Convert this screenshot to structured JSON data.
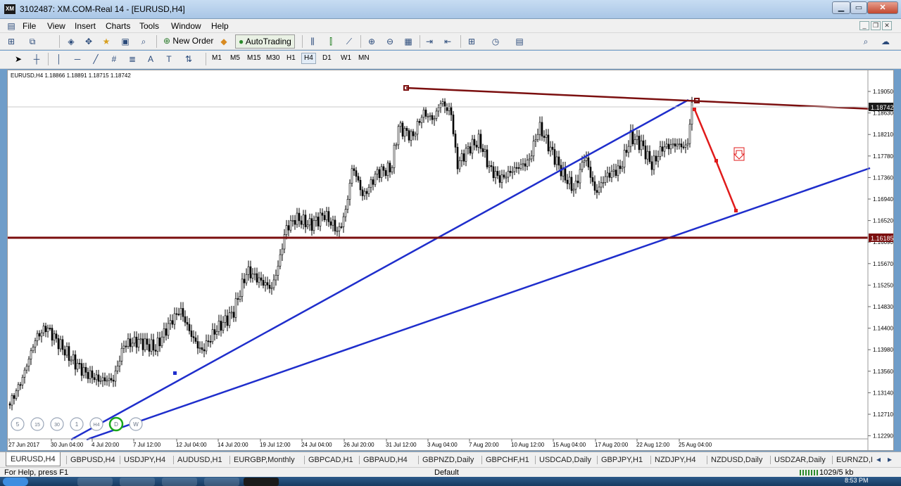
{
  "window": {
    "title": "3102487: XM.COM-Real 14 - [EURUSD,H4]",
    "app_icon": "XM"
  },
  "menu": [
    "File",
    "View",
    "Insert",
    "Charts",
    "Tools",
    "Window",
    "Help"
  ],
  "toolbar": {
    "new_order": "New Order",
    "autotrading": "AutoTrading"
  },
  "timeframes": [
    "M1",
    "M5",
    "M15",
    "M30",
    "H1",
    "H4",
    "D1",
    "W1",
    "MN"
  ],
  "active_timeframe": "H4",
  "chart": {
    "header": "EURUSD,H4  1.18866 1.18891 1.18715 1.18742",
    "current_price": "1.18742",
    "level_price": "1.16185",
    "price_ticks": [
      "1.19050",
      "1.18630",
      "1.18210",
      "1.17780",
      "1.17360",
      "1.16940",
      "1.16520",
      "1.16090",
      "1.15670",
      "1.15250",
      "1.14830",
      "1.14400",
      "1.13980",
      "1.13560",
      "1.13140",
      "1.12710",
      "1.12290"
    ],
    "date_ticks": [
      "27 Jun 2017",
      "30 Jun 04:00",
      "4 Jul 20:00",
      "7 Jul 12:00",
      "12 Jul 04:00",
      "14 Jul 20:00",
      "19 Jul 12:00",
      "24 Jul 04:00",
      "26 Jul 20:00",
      "31 Jul 12:00",
      "3 Aug 04:00",
      "7 Aug 20:00",
      "10 Aug 12:00",
      "15 Aug 04:00",
      "17 Aug 20:00",
      "22 Aug 12:00",
      "25 Aug 04:00"
    ],
    "overlay_buttons": [
      "5",
      "15",
      "30",
      "1",
      "H4",
      "D",
      "W"
    ],
    "colors": {
      "trend": "#1f2ecc",
      "resistance": "#7b0f0f",
      "projection": "#e01b1b",
      "candle": "#000000"
    }
  },
  "tabs": [
    "EURUSD,H4",
    "GBPUSD,H4",
    "USDJPY,H4",
    "AUDUSD,H1",
    "EURGBP,Monthly",
    "GBPCAD,H1",
    "GBPAUD,H4",
    "GBPNZD,Daily",
    "GBPCHF,H1",
    "USDCAD,Daily",
    "GBPJPY,H1",
    "NZDJPY,H4",
    "NZDUSD,Daily",
    "USDZAR,Daily",
    "EURNZD,I"
  ],
  "status": {
    "help": "For Help, press F1",
    "profile": "Default",
    "traffic": "1029/5 kb"
  },
  "taskbar": {
    "time": "8:53 PM"
  }
}
